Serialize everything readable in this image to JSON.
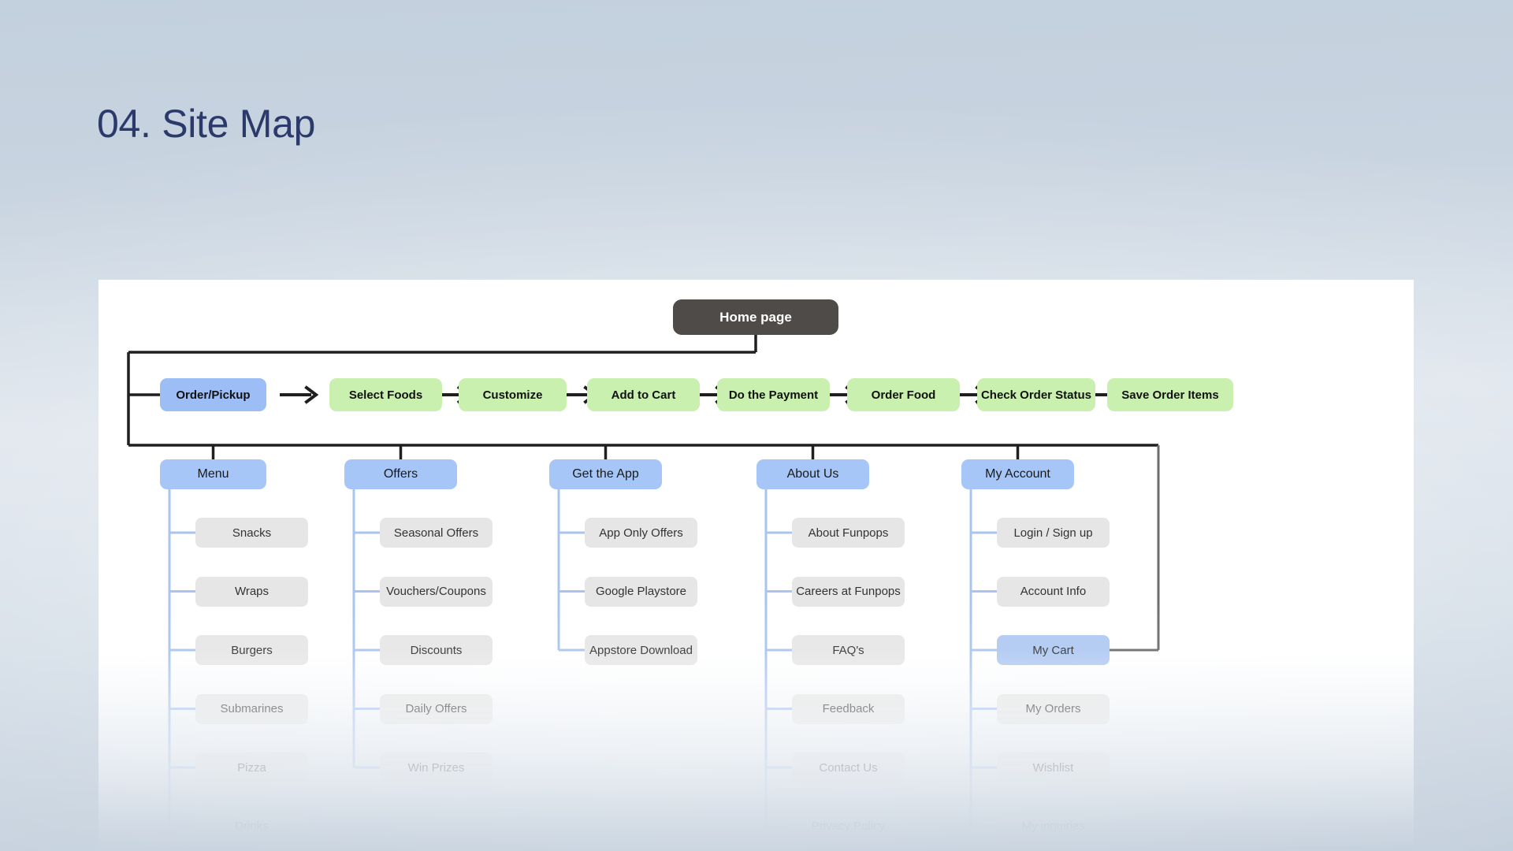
{
  "page": {
    "title": "04. Site Map",
    "accent_title_color": "#2b3a6b",
    "background_color": "#c8d4e0",
    "panel_color": "#ffffff"
  },
  "colors": {
    "root_node": "#4e4b48",
    "flow_green": "#c9f0ae",
    "flow_blue": "#9dbdf7",
    "section_node": "#a6c6f7",
    "leaf_node": "#e6e6e6",
    "leaf_highlight": "#b0c9f2",
    "connector_dark": "#1f1f1f",
    "connector_light": "#a8c4ef"
  },
  "root": {
    "label": "Home page"
  },
  "flow": {
    "steps": [
      {
        "label": "Order/Pickup",
        "style": "blue"
      },
      {
        "label": "Select Foods",
        "style": "green"
      },
      {
        "label": "Customize",
        "style": "green"
      },
      {
        "label": "Add to Cart",
        "style": "green"
      },
      {
        "label": "Do the Payment",
        "style": "green"
      },
      {
        "label": "Order Food",
        "style": "green"
      },
      {
        "label": "Check Order Status",
        "style": "green"
      },
      {
        "label": "Save Order Items",
        "style": "green"
      }
    ]
  },
  "sections": [
    {
      "label": "Menu",
      "children": [
        {
          "label": "Snacks"
        },
        {
          "label": "Wraps"
        },
        {
          "label": "Burgers"
        },
        {
          "label": "Submarines"
        },
        {
          "label": "Pizza"
        },
        {
          "label": "Drinks"
        }
      ]
    },
    {
      "label": "Offers",
      "children": [
        {
          "label": "Seasonal Offers"
        },
        {
          "label": "Vouchers/Coupons"
        },
        {
          "label": "Discounts"
        },
        {
          "label": "Daily Offers"
        },
        {
          "label": "Win Prizes"
        }
      ]
    },
    {
      "label": "Get the App",
      "children": [
        {
          "label": "App Only Offers"
        },
        {
          "label": "Google Playstore"
        },
        {
          "label": "Appstore Download"
        }
      ]
    },
    {
      "label": "About Us",
      "children": [
        {
          "label": "About Funpops"
        },
        {
          "label": "Careers at Funpops"
        },
        {
          "label": "FAQ's"
        },
        {
          "label": "Feedback"
        },
        {
          "label": "Contact Us"
        },
        {
          "label": "Privacy Policy"
        }
      ]
    },
    {
      "label": "My Account",
      "children": [
        {
          "label": "Login / Sign up"
        },
        {
          "label": "Account Info"
        },
        {
          "label": "My Cart",
          "highlighted": true
        },
        {
          "label": "My Orders"
        },
        {
          "label": "Wishlist"
        },
        {
          "label": "My inquiries"
        }
      ]
    }
  ]
}
